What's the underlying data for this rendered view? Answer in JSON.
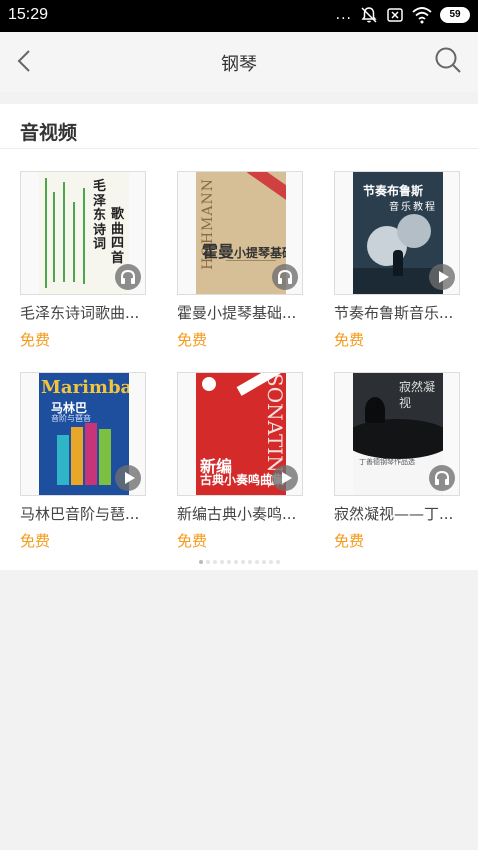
{
  "status_bar": {
    "time": "15:29",
    "dots": "...",
    "battery": "59"
  },
  "nav": {
    "title": "钢琴"
  },
  "section": {
    "title": "音视频"
  },
  "items": [
    {
      "title": "毛泽东诗词歌曲...",
      "price": "免费",
      "badge": "headphones",
      "cover": {
        "col1": "毛泽东诗词",
        "col2": "歌曲四首"
      }
    },
    {
      "title": "霍曼小提琴基础...",
      "price": "免费",
      "badge": "headphones",
      "cover": {
        "side": "HOHMANN",
        "main": "霍曼",
        "sub": "小提琴基础教程"
      }
    },
    {
      "title": "节奏布鲁斯音乐...",
      "price": "免费",
      "badge": "play",
      "cover": {
        "main": "节奏布鲁斯",
        "sub": "音乐教程"
      }
    },
    {
      "title": "马林巴音阶与琶...",
      "price": "免费",
      "badge": "play",
      "cover": {
        "main": "Marimba",
        "sub": "马林巴",
        "sub2": "音阶与琶音"
      }
    },
    {
      "title": "新编古典小奏鸣...",
      "price": "免费",
      "badge": "play",
      "cover": {
        "side": "SONATINA",
        "main": "新编",
        "sub": "古典小奏鸣曲集"
      }
    },
    {
      "title": "寂然凝视——丁...",
      "price": "免费",
      "badge": "headphones",
      "cover": {
        "main": "寂然凝视",
        "sub": "丁善德钢琴作品选"
      }
    }
  ],
  "pager": {
    "count": 12,
    "active_index": 0
  },
  "colors": {
    "price": "#f59a1b",
    "status_bar_bg": "#000000",
    "page_bg": "#f2f2f2"
  }
}
